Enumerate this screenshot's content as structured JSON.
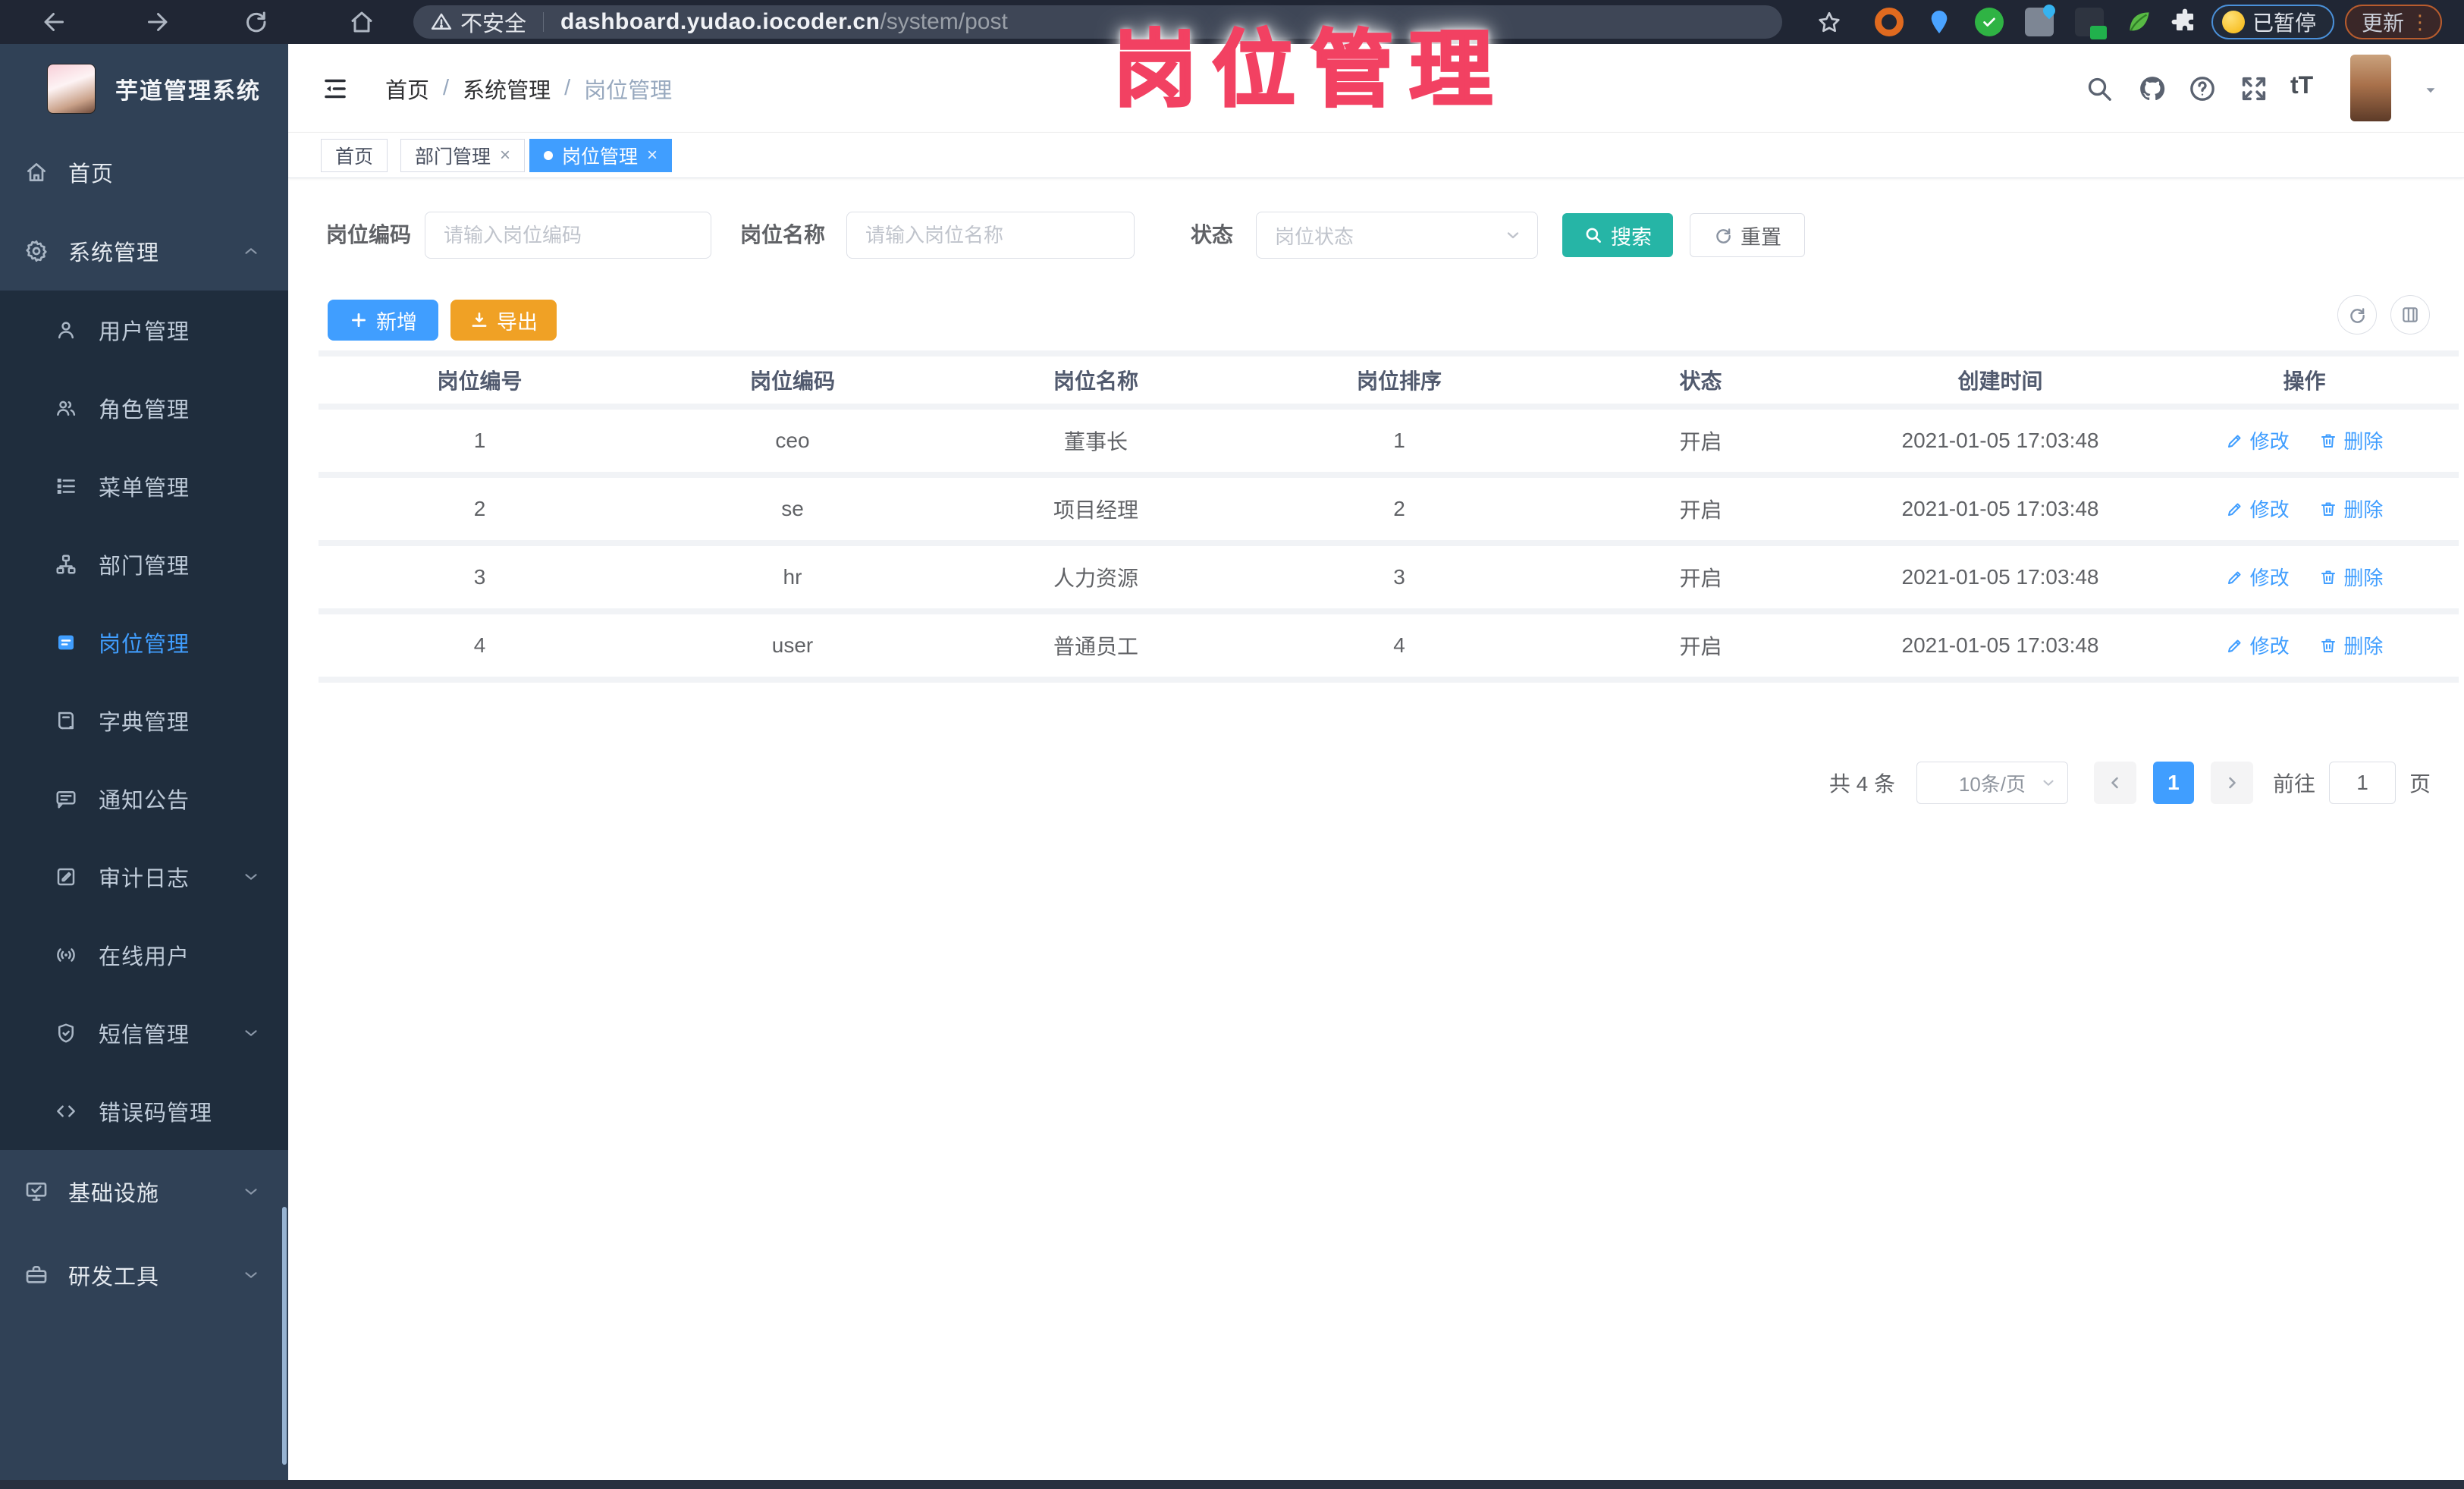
{
  "browser": {
    "security_label": "不安全",
    "url_domain": "dashboard.yudao.iocoder.cn",
    "url_path": "/system/post",
    "paused_badge": "已暂停",
    "update_button": "更新",
    "menu_dots": "⋮"
  },
  "overlay": {
    "title": "岗位管理"
  },
  "sidebar": {
    "app_title": "芋道管理系统",
    "items": [
      {
        "label": "首页"
      },
      {
        "label": "系统管理"
      },
      {
        "label": "用户管理"
      },
      {
        "label": "角色管理"
      },
      {
        "label": "菜单管理"
      },
      {
        "label": "部门管理"
      },
      {
        "label": "岗位管理"
      },
      {
        "label": "字典管理"
      },
      {
        "label": "通知公告"
      },
      {
        "label": "审计日志"
      },
      {
        "label": "在线用户"
      },
      {
        "label": "短信管理"
      },
      {
        "label": "错误码管理"
      },
      {
        "label": "基础设施"
      },
      {
        "label": "研发工具"
      }
    ]
  },
  "header": {
    "breadcrumb": [
      "首页",
      "系统管理",
      "岗位管理"
    ],
    "separator": "/"
  },
  "tabs": [
    {
      "label": "首页"
    },
    {
      "label": "部门管理"
    },
    {
      "label": "岗位管理"
    }
  ],
  "filters": {
    "code_label": "岗位编码",
    "code_placeholder": "请输入岗位编码",
    "name_label": "岗位名称",
    "name_placeholder": "请输入岗位名称",
    "status_label": "状态",
    "status_placeholder": "岗位状态",
    "search_label": "搜索",
    "reset_label": "重置"
  },
  "toolbar": {
    "add_label": "新增",
    "export_label": "导出"
  },
  "table": {
    "columns": [
      "岗位编号",
      "岗位编码",
      "岗位名称",
      "岗位排序",
      "状态",
      "创建时间",
      "操作"
    ],
    "edit_label": "修改",
    "delete_label": "删除",
    "rows": [
      {
        "id": "1",
        "code": "ceo",
        "name": "董事长",
        "sort": "1",
        "status": "开启",
        "created": "2021-01-05 17:03:48"
      },
      {
        "id": "2",
        "code": "se",
        "name": "项目经理",
        "sort": "2",
        "status": "开启",
        "created": "2021-01-05 17:03:48"
      },
      {
        "id": "3",
        "code": "hr",
        "name": "人力资源",
        "sort": "3",
        "status": "开启",
        "created": "2021-01-05 17:03:48"
      },
      {
        "id": "4",
        "code": "user",
        "name": "普通员工",
        "sort": "4",
        "status": "开启",
        "created": "2021-01-05 17:03:48"
      }
    ]
  },
  "pagination": {
    "total_text": "共 4 条",
    "page_size": "10条/页",
    "current_page": "1",
    "goto_label": "前往",
    "goto_value": "1",
    "page_suffix": "页"
  },
  "colors": {
    "accent": "#409eff",
    "search_button": "#26b5a6",
    "export_button": "#f0a125",
    "overlay_text": "#f24162",
    "sidebar_bg": "#304156",
    "submenu_bg": "#1f2d3d"
  }
}
